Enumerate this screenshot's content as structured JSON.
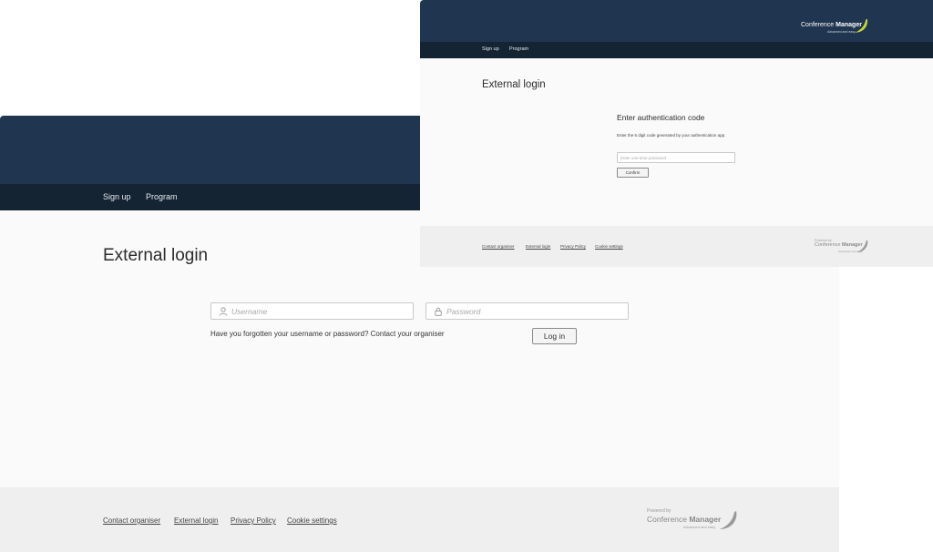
{
  "back_window": {
    "nav": {
      "items": [
        "Sign up",
        "Program"
      ]
    },
    "page_title": "External login",
    "username": {
      "placeholder": "Username",
      "value": ""
    },
    "password": {
      "placeholder": "Password",
      "value": ""
    },
    "forgot_text": "Have you forgotten your username or password? Contact your organiser",
    "login_button": "Log in",
    "footer": {
      "links": [
        "Contact organiser",
        "External login",
        "Privacy Policy",
        "Cookie settings"
      ],
      "powered_by": "Powered by",
      "brand_light": "Conference",
      "brand_bold": "Manager",
      "brand_sub": "Advanced and easy"
    }
  },
  "front_window": {
    "header_logo": {
      "brand_light": "Conference",
      "brand_bold": "Manager",
      "brand_sub": "Advanced and easy"
    },
    "nav": {
      "items": [
        "Sign up",
        "Program"
      ]
    },
    "page_title": "External login",
    "section_title": "Enter authentication code",
    "instructions": "Enter the 6 digit code generated by your authentication app.",
    "code_input": {
      "placeholder": "Enter one-time password",
      "value": ""
    },
    "confirm_button": "Confirm",
    "footer": {
      "links": [
        "Contact organiser",
        "External login",
        "Privacy Policy",
        "Cookie settings"
      ],
      "powered_by": "Powered by",
      "brand_light": "Conference",
      "brand_bold": "Manager",
      "brand_sub": "Advanced and easy"
    }
  },
  "colors": {
    "header": "#1f3550",
    "nav": "#152433",
    "page_bg": "#fafafa",
    "footer_bg": "#efefef",
    "logo_accent": "#c6d733",
    "logo_grey": "#9a9a9a"
  },
  "icons": {
    "username": "user-icon",
    "password": "lock-icon",
    "logo": "banana-logo-icon"
  }
}
